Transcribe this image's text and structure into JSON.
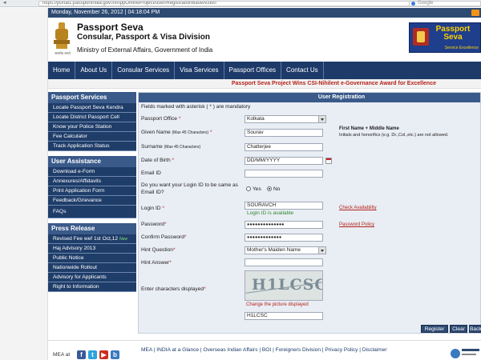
{
  "browser": {
    "url": "https://portal1.passportindia.gov.in/AppOnlineProject/user/RegistrationBaseAction",
    "url_host": "passportindia.gov.in",
    "search_placeholder": "Google"
  },
  "datebar": {
    "text": "Monday, November 26, 2012 | 04:18:04 PM"
  },
  "header": {
    "title": "Passport Seva",
    "subtitle": "Consular, Passport & Visa Division",
    "ministry": "Ministry of External Affairs, Government of India",
    "emblem_caption": "सत्यमेव जयते",
    "logo_title": "Passport Seva",
    "logo_sub": "Service Excellence"
  },
  "nav": [
    "Home",
    "About Us",
    "Consular Services",
    "Visa Services",
    "Passport Offices",
    "Contact Us"
  ],
  "award_text": "Passport Seva Project Wins CSI-Nihilent e-Governance Award for Excellence",
  "sidebar": {
    "passport_services": {
      "heading": "Passport Services",
      "items": [
        "Locate Passport Seva Kendra",
        "Locate District Passport Cell",
        "Know your Police Station",
        "Fee Calculator",
        "Track Application Status"
      ]
    },
    "user_assistance": {
      "heading": "User Assistance",
      "items": [
        "Download e-Form",
        "Annexures/Affidavits",
        "Print Application Form",
        "Feedback/Grievance",
        "FAQs"
      ]
    },
    "press_release": {
      "heading": "Press Release",
      "items": [
        "Revised Fee wef 1st Oct,12",
        "Haj Advisory 2013",
        "Public Notice",
        "Nationwide Rollout",
        "Advisory for Applicants",
        "Right to Information"
      ],
      "new_tag": "New"
    }
  },
  "form": {
    "heading": "User Registration",
    "mandatory_note": "Fields marked with asterisk ( * ) are mandatory",
    "passport_office_label": "Passport Office",
    "passport_office_value": "Kolkata",
    "given_name_label": "Given Name",
    "given_name_hint": "(Max 45 Characters)",
    "given_name_value": "Sourav",
    "surname_label": "Surname",
    "surname_hint": "(Max 45 Characters)",
    "surname_value": "Chatterjee",
    "dob_label": "Date of Birth",
    "dob_value": "DD/MM/YYYY",
    "email_label": "Email ID",
    "login_same_q1": "Do you want your Login ID to be same as",
    "login_same_q2": "Email ID?",
    "yes_label": "Yes",
    "no_label": "No",
    "login_id_label": "Login ID",
    "login_id_value": "SOURAVCH",
    "login_available": "Login ID is available",
    "check_availability": "Check Availability",
    "password_label": "Password",
    "password_value": "●●●●●●●●●●●●●●",
    "password_policy": "Password Policy",
    "confirm_password_label": "Confirm Password",
    "confirm_password_value": "●●●●●●●●●●●●●",
    "hint_question_label": "Hint Question",
    "hint_question_value": "Mother's Maiden Name",
    "hint_answer_label": "Hint Answer",
    "captcha_label": "Enter characters displayed",
    "captcha_text": "H1LCSC",
    "change_picture": "Change the picture displayed",
    "captcha_value": "H1LCSC",
    "name_note_title": "First Name + Middle Name",
    "name_note_body": "Initials and honorifics (e.g. Dr.,Col.,etc.) are not allowed.",
    "asterisk": "*",
    "buttons": {
      "register": "Register",
      "clear": "Clear",
      "back": "Back"
    }
  },
  "footer": {
    "mea_label": "MEA at",
    "links": "MEA | INDIA at a Glance | Overseas Indian Affairs | BOI | Foreigners Division | Privacy Policy | Disclaimer"
  }
}
